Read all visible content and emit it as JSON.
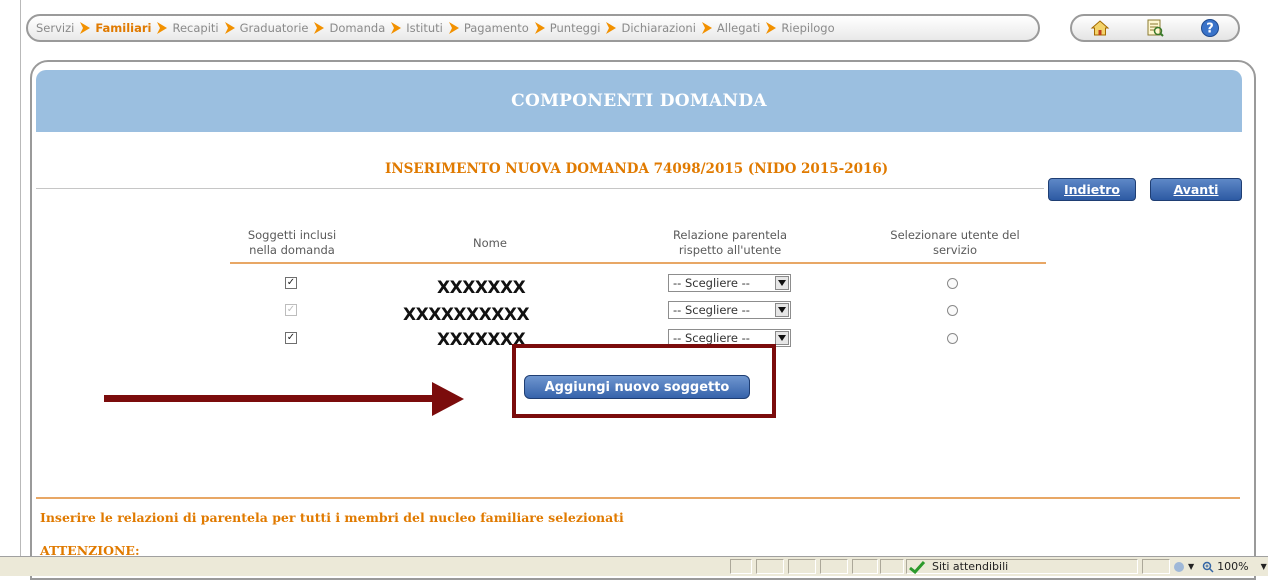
{
  "breadcrumb": {
    "items": [
      {
        "label": "Servizi",
        "active": false
      },
      {
        "label": "Familiari",
        "active": true
      },
      {
        "label": "Recapiti",
        "active": false
      },
      {
        "label": "Graduatorie",
        "active": false
      },
      {
        "label": "Domanda",
        "active": false
      },
      {
        "label": "Istituti",
        "active": false
      },
      {
        "label": "Pagamento",
        "active": false
      },
      {
        "label": "Punteggi",
        "active": false
      },
      {
        "label": "Dichiarazioni",
        "active": false
      },
      {
        "label": "Allegati",
        "active": false
      },
      {
        "label": "Riepilogo",
        "active": false
      }
    ]
  },
  "toolbar": {
    "icons": [
      "home-icon",
      "document-search-icon",
      "help-icon"
    ]
  },
  "panel": {
    "title": "COMPONENTI DOMANDA",
    "subtitle": "INSERIMENTO NUOVA DOMANDA 74098/2015 (NIDO 2015-2016)"
  },
  "nav": {
    "back_label": "Indietro",
    "next_label": "Avanti"
  },
  "table": {
    "headers": {
      "included": "Soggetti inclusi nella domanda",
      "name": "Nome",
      "relation": "Relazione parentela rispetto all'utente",
      "service_user": "Selezionare utente del servizio"
    },
    "rows": [
      {
        "included": true,
        "disabled": false,
        "name": "XXXXXXX",
        "relation": "-- Scegliere --",
        "selected": false
      },
      {
        "included": true,
        "disabled": true,
        "name": "XXXXXXXXXX",
        "relation": "-- Scegliere --",
        "selected": false
      },
      {
        "included": true,
        "disabled": false,
        "name": "XXXXXXX",
        "relation": "-- Scegliere --",
        "selected": false
      }
    ]
  },
  "add_button_label": "Aggiungi nuovo soggetto",
  "info_text": "Inserire le relazioni di parentela per tutti i membri del nucleo familiare selezionati",
  "warning_text": "ATTENZIONE:",
  "statusbar": {
    "zone": "Siti attendibili",
    "zoom": "100%"
  },
  "colors": {
    "accent_orange": "#e07a00",
    "header_blue": "#9bbfe0",
    "button_blue": "#2d5aa3",
    "annotation_red": "#7b0c0c"
  }
}
